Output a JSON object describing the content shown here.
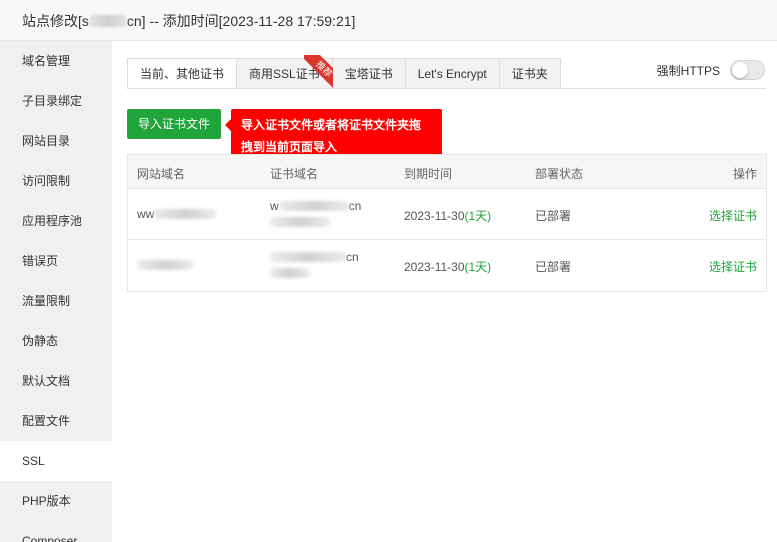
{
  "window": {
    "title_prefix": "站点修改[s",
    "title_suffix": "cn] -- 添加时间[2023-11-28 17:59:21]"
  },
  "sidebar": {
    "items": [
      {
        "label": "域名管理"
      },
      {
        "label": "子目录绑定"
      },
      {
        "label": "网站目录"
      },
      {
        "label": "访问限制"
      },
      {
        "label": "应用程序池"
      },
      {
        "label": "错误页"
      },
      {
        "label": "流量限制"
      },
      {
        "label": "伪静态"
      },
      {
        "label": "默认文档"
      },
      {
        "label": "配置文件"
      },
      {
        "label": "SSL",
        "active": true
      },
      {
        "label": "PHP版本"
      },
      {
        "label": "Composer"
      }
    ]
  },
  "tabs": [
    {
      "label": "当前、其他证书",
      "active": true
    },
    {
      "label": "商用SSL证书",
      "badge": "推荐"
    },
    {
      "label": "宝塔证书"
    },
    {
      "label": "Let's Encrypt"
    },
    {
      "label": "证书夹"
    }
  ],
  "https_toggle": {
    "label": "强制HTTPS",
    "on": false
  },
  "import_button": {
    "label": "导入证书文件"
  },
  "tooltip": {
    "line1": "导入证书文件或者将证书文件夹拖",
    "line2": "拽到当前页面导入"
  },
  "table": {
    "headers": [
      "网站域名",
      "证书域名",
      "到期时间",
      "部署状态",
      "操作"
    ],
    "rows": [
      {
        "site_prefix": "ww",
        "cert_line1": "w",
        "cert_line1_suffix": "cn",
        "expiry_date": "2023-11-30",
        "expiry_days": "(1天)",
        "status": "已部署",
        "action": "选择证书"
      },
      {
        "site_prefix": "",
        "cert_line1": "",
        "cert_line1_suffix": "cn",
        "expiry_date": "2023-11-30",
        "expiry_days": "(1天)",
        "status": "已部署",
        "action": "选择证书"
      }
    ]
  },
  "colors": {
    "accent_green": "#20a53a",
    "tooltip_red": "#ff0000",
    "ribbon_red": "#d9382f"
  }
}
